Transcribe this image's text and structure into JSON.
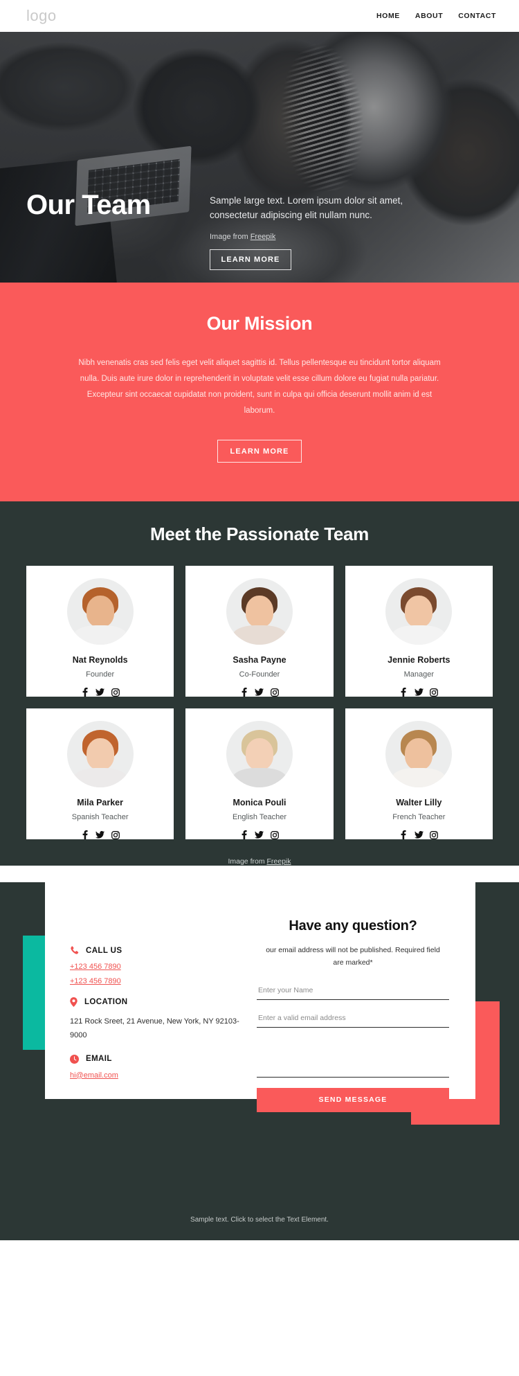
{
  "header": {
    "logo": "logo",
    "nav": [
      {
        "label": "HOME"
      },
      {
        "label": "ABOUT"
      },
      {
        "label": "CONTACT"
      }
    ]
  },
  "hero": {
    "title": "Our Team",
    "subtitle": "Sample large text. Lorem ipsum dolor sit amet, consectetur adipiscing elit nullam nunc.",
    "credit_prefix": "Image from ",
    "credit_link": "Freepik",
    "button": "LEARN MORE"
  },
  "mission": {
    "title": "Our Mission",
    "body": "Nibh venenatis cras sed felis eget velit aliquet sagittis id. Tellus pellentesque eu tincidunt tortor aliquam nulla. Duis aute irure dolor in reprehenderit in voluptate velit esse cillum dolore eu fugiat nulla pariatur. Excepteur sint occaecat cupidatat non proident, sunt in culpa qui officia deserunt mollit anim id est laborum.",
    "button": "LEARN MORE",
    "bg_color": "#fa5a5a"
  },
  "team": {
    "title": "Meet the Passionate Team",
    "credit_prefix": "Image from ",
    "credit_link": "Freepik",
    "members": [
      {
        "name": "Nat Reynolds",
        "role": "Founder"
      },
      {
        "name": "Sasha Payne",
        "role": "Co-Founder"
      },
      {
        "name": "Jennie Roberts",
        "role": "Manager"
      },
      {
        "name": "Mila Parker",
        "role": "Spanish Teacher"
      },
      {
        "name": "Monica Pouli",
        "role": "English Teacher"
      },
      {
        "name": "Walter Lilly",
        "role": "French Teacher"
      }
    ],
    "social_icons": [
      "facebook-icon",
      "twitter-icon",
      "instagram-icon"
    ],
    "bg_color": "#2c3735"
  },
  "contact": {
    "call_us": {
      "icon": "phone-icon",
      "label": "CALL US",
      "phone_1": "+123 456 7890",
      "phone_2": "+123 456 7890"
    },
    "location": {
      "icon": "map-pin-icon",
      "label": "LOCATION",
      "address": "121 Rock Sreet, 21 Avenue, New York, NY 92103-9000"
    },
    "email": {
      "icon": "clock-icon",
      "label": "EMAIL",
      "address": "hi@email.com"
    },
    "form": {
      "title": "Have any question?",
      "note": "our email address will not be published. Required field are marked*",
      "name_placeholder": "Enter your Name",
      "email_placeholder": "Enter a valid email address",
      "message_placeholder": "",
      "submit": "SEND MESSAGE"
    },
    "accent_teal": "#0bb9a0",
    "accent_red": "#fa5a5a"
  },
  "footer": {
    "text": "Sample text. Click to select the Text Element."
  }
}
